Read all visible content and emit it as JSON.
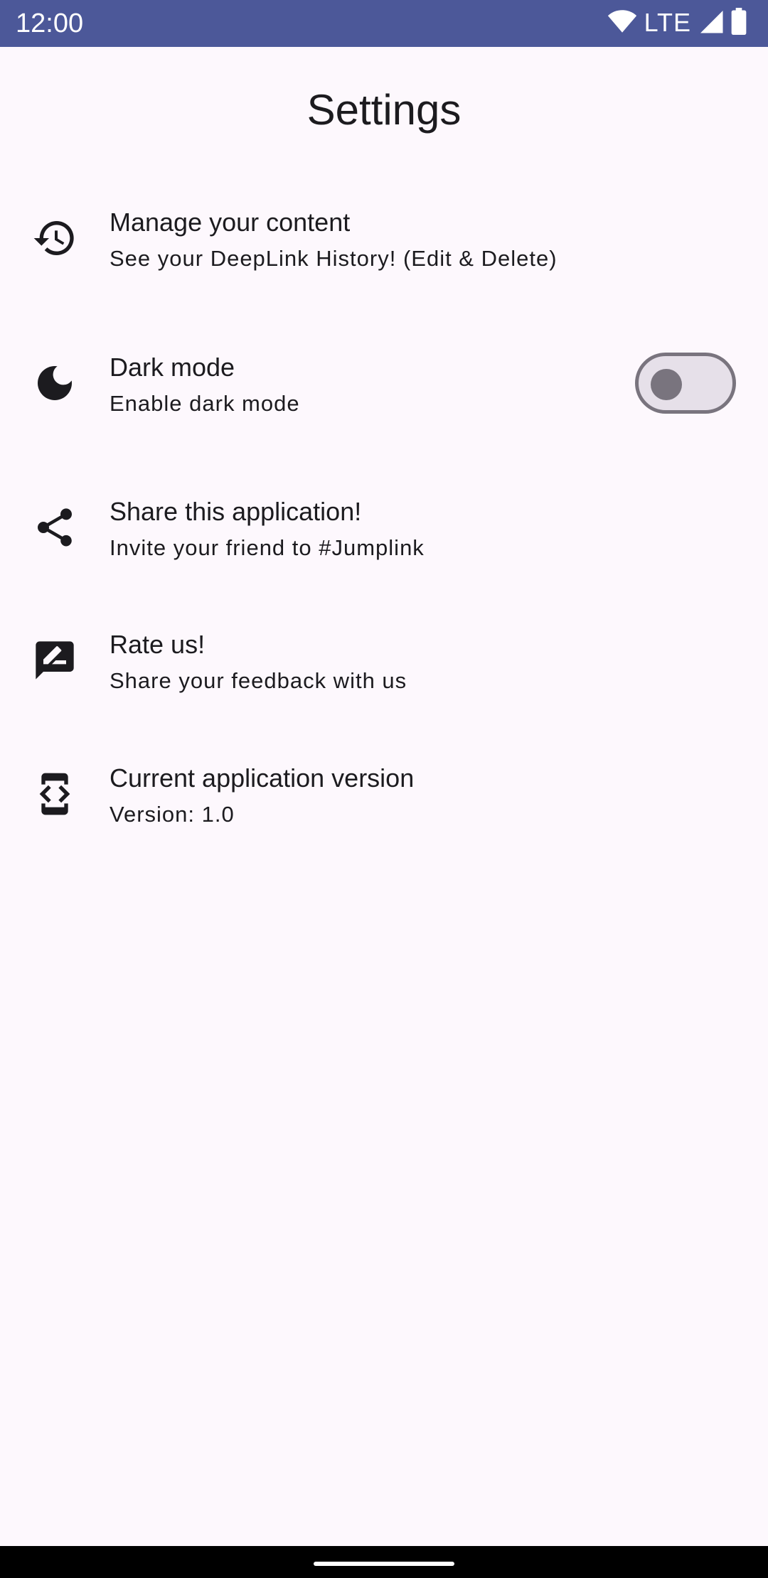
{
  "status_bar": {
    "time": "12:00",
    "network": "LTE",
    "background_color": "#4c5899",
    "icons": [
      "wifi-icon",
      "signal-icon",
      "battery-icon"
    ]
  },
  "page": {
    "title": "Settings"
  },
  "settings": [
    {
      "icon": "history-icon",
      "title": "Manage your content",
      "subtitle": "See your DeepLink History! (Edit & Delete)"
    },
    {
      "icon": "moon-icon",
      "title": "Dark mode",
      "subtitle": "Enable dark mode",
      "toggle_on": false
    },
    {
      "icon": "share-icon",
      "title": "Share this application!",
      "subtitle": "Invite your friend to #Jumplink"
    },
    {
      "icon": "rate-review-icon",
      "title": "Rate us!",
      "subtitle": "Share your feedback with us"
    },
    {
      "icon": "developer-mode-icon",
      "title": "Current application version",
      "subtitle": "Version: 1.0"
    }
  ],
  "colors": {
    "background": "#fdf8fd",
    "text": "#1c1b1f",
    "toggle_outline": "#79747e",
    "toggle_track": "#e6e0e9"
  }
}
